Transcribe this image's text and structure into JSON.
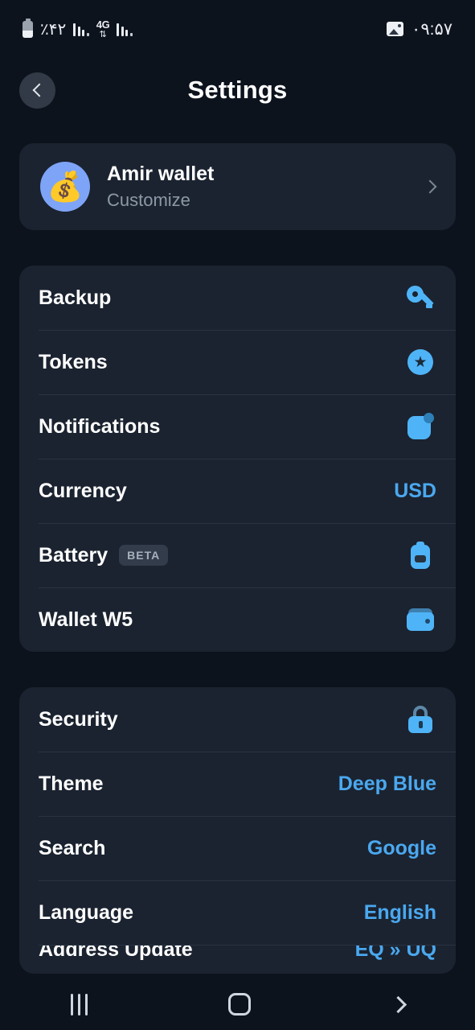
{
  "status_bar": {
    "battery_percent": "٪۴۲",
    "network_type": "4G",
    "time": "۰۹:۵۷",
    "battery_icon": "battery-icon",
    "signal_icon": "signal-bars-icon",
    "data_arrows_icon": "data-transfer-icon",
    "image_icon": "photo-icon"
  },
  "header": {
    "title": "Settings",
    "back_icon": "chevron-left-icon"
  },
  "wallet": {
    "name": "Amir wallet",
    "subtitle": "Customize",
    "avatar_emoji": "💰",
    "chevron_icon": "chevron-right-icon"
  },
  "group_one": [
    {
      "label": "Backup",
      "value": "",
      "icon": "key-icon",
      "badge": ""
    },
    {
      "label": "Tokens",
      "value": "",
      "icon": "star-circle-icon",
      "badge": ""
    },
    {
      "label": "Notifications",
      "value": "",
      "icon": "notification-badge-icon",
      "badge": ""
    },
    {
      "label": "Currency",
      "value": "USD",
      "icon": "",
      "badge": ""
    },
    {
      "label": "Battery",
      "value": "",
      "icon": "battery-icon",
      "badge": "BETA"
    },
    {
      "label": "Wallet W5",
      "value": "",
      "icon": "wallet-icon",
      "badge": ""
    }
  ],
  "group_two": [
    {
      "label": "Security",
      "value": "",
      "icon": "lock-icon"
    },
    {
      "label": "Theme",
      "value": "Deep Blue",
      "icon": ""
    },
    {
      "label": "Search",
      "value": "Google",
      "icon": ""
    },
    {
      "label": "Language",
      "value": "English",
      "icon": ""
    },
    {
      "label": "Address Update",
      "value": "EQ » UQ",
      "icon": ""
    }
  ],
  "nav_bar": {
    "recents_icon": "recents-icon",
    "home_icon": "home-icon",
    "back_icon": "back-icon"
  },
  "colors": {
    "background": "#0d131d",
    "card": "#1b2330",
    "accent": "#4aa8ef",
    "icon_blue": "#4fb4f7",
    "avatar_blue": "#7ea4f7",
    "text_primary": "#ffffff",
    "text_secondary": "#8d98a6"
  }
}
